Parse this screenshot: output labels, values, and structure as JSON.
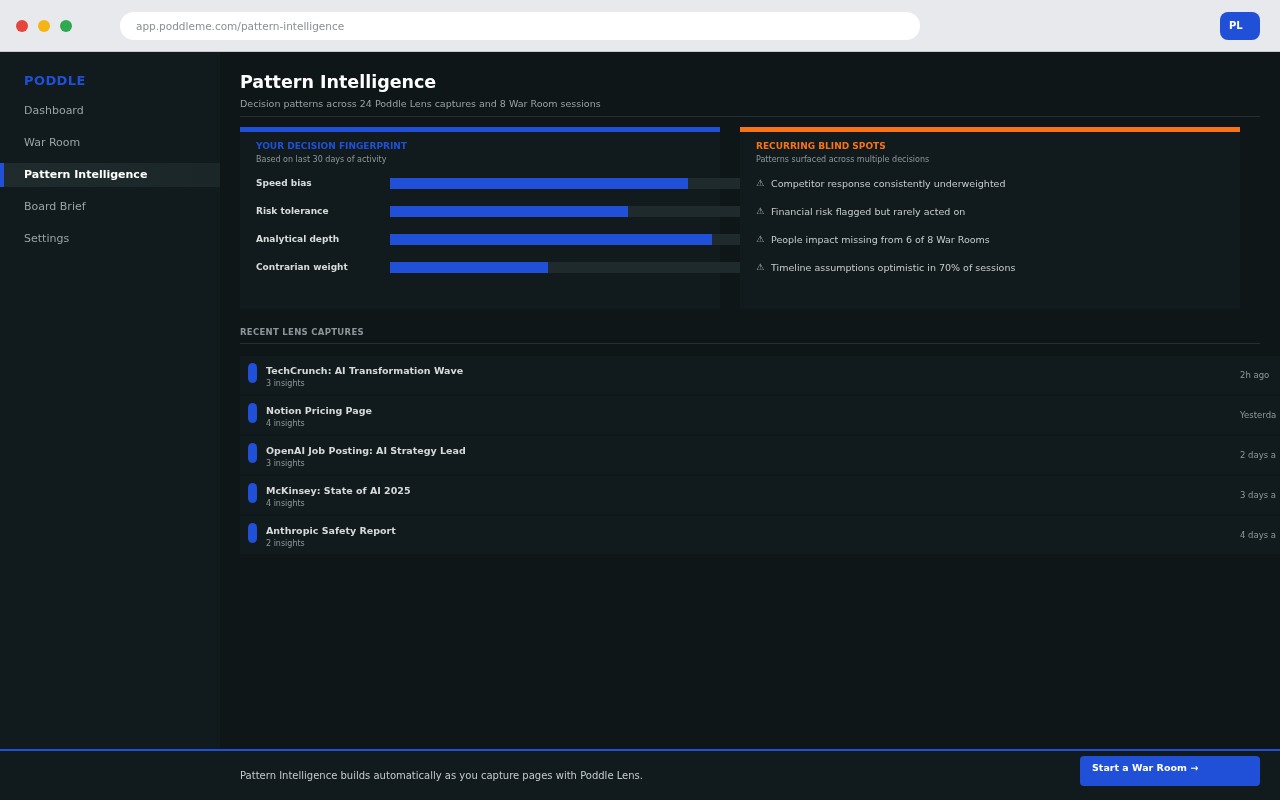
{
  "browser": {
    "url": "app.poddleme.com/pattern-intelligence",
    "avatar": "PL"
  },
  "sidebar": {
    "logo": "PODDLE",
    "items": [
      {
        "label": "Dashboard",
        "selected": false
      },
      {
        "label": "War Room",
        "selected": false
      },
      {
        "label": "Pattern Intelligence",
        "selected": true
      },
      {
        "label": "Board Brief",
        "selected": false
      },
      {
        "label": "Settings",
        "selected": false
      }
    ]
  },
  "page": {
    "title": "Pattern Intelligence",
    "subtitle": "Decision patterns across 24 Poddle Lens captures and 8 War Room sessions"
  },
  "fingerprint": {
    "title": "YOUR DECISION FINGERPRINT",
    "subtitle": "Based on last 30 days of activity",
    "traits": [
      {
        "name": "Speed bias",
        "level": 0.85
      },
      {
        "name": "Risk tolerance",
        "level": 0.68
      },
      {
        "name": "Analytical depth",
        "level": 0.92
      },
      {
        "name": "Contrarian weight",
        "level": 0.45
      }
    ]
  },
  "blind_spots": {
    "title": "RECURRING BLIND SPOTS",
    "subtitle": "Patterns surfaced across multiple decisions",
    "items": [
      {
        "icon": "⚠",
        "text": "Competitor response consistently underweighted"
      },
      {
        "icon": "⚠",
        "text": "Financial risk flagged but rarely acted on"
      },
      {
        "icon": "⚠",
        "text": "People impact missing from 6 of 8 War Rooms"
      },
      {
        "icon": "⚠",
        "text": "Timeline assumptions optimistic in 70% of sessions"
      }
    ]
  },
  "recent_captures": {
    "title": "RECENT LENS CAPTURES",
    "items": [
      {
        "title": "TechCrunch: AI Transformation Wave",
        "insights": "3 insights",
        "time": "2h ago"
      },
      {
        "title": "Notion Pricing Page",
        "insights": "4 insights",
        "time": "Yesterda"
      },
      {
        "title": "OpenAI Job Posting: AI Strategy Lead",
        "insights": "3 insights",
        "time": "2 days a"
      },
      {
        "title": "McKinsey: State of AI 2025",
        "insights": "4 insights",
        "time": "3 days a"
      },
      {
        "title": "Anthropic Safety Report",
        "insights": "2 insights",
        "time": "4 days a"
      }
    ]
  },
  "footer": {
    "text": "Pattern Intelligence builds automatically as you capture pages with Poddle Lens.",
    "button": "Start a War Room →"
  }
}
